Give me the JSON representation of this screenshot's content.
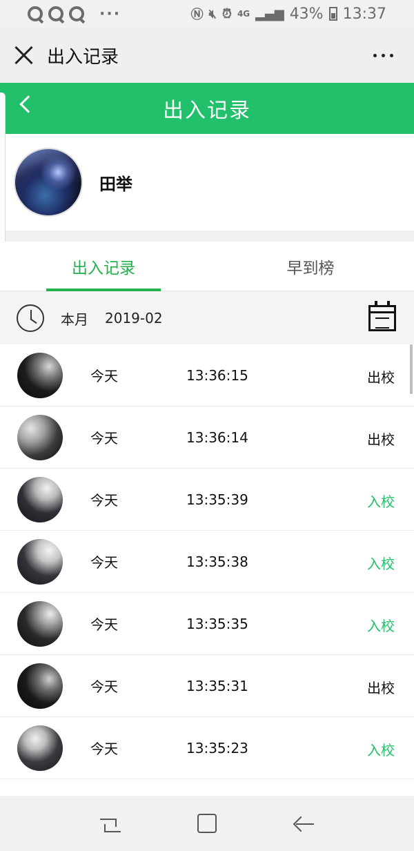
{
  "status_bar": {
    "dots": "···",
    "network": "4G",
    "battery": "43%",
    "time": "13:37"
  },
  "topbar": {
    "title": "出入记录"
  },
  "header": {
    "title": "出入记录"
  },
  "profile": {
    "name": "田举"
  },
  "tabs": [
    {
      "label": "出入记录",
      "active": true
    },
    {
      "label": "早到榜",
      "active": false
    }
  ],
  "month": {
    "label": "本月",
    "value": "2019-02"
  },
  "records": [
    {
      "day": "今天",
      "time": "13:36:15",
      "status": "出校",
      "direction": "out"
    },
    {
      "day": "今天",
      "time": "13:36:14",
      "status": "出校",
      "direction": "out"
    },
    {
      "day": "今天",
      "time": "13:35:39",
      "status": "入校",
      "direction": "in"
    },
    {
      "day": "今天",
      "time": "13:35:38",
      "status": "入校",
      "direction": "in"
    },
    {
      "day": "今天",
      "time": "13:35:35",
      "status": "入校",
      "direction": "in"
    },
    {
      "day": "今天",
      "time": "13:35:31",
      "status": "出校",
      "direction": "out"
    },
    {
      "day": "今天",
      "time": "13:35:23",
      "status": "入校",
      "direction": "in"
    }
  ],
  "colors": {
    "brand_green": "#22c06a",
    "tab_active": "#22b14c",
    "in_status": "#22c06a"
  }
}
